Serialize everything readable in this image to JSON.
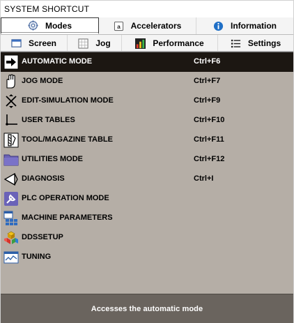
{
  "window": {
    "title": "SYSTEM SHORTCUT"
  },
  "tabs_row1": [
    {
      "label": "Modes",
      "icon": "gear-icon",
      "active": true
    },
    {
      "label": "Accelerators",
      "icon": "key-a-icon",
      "active": false
    },
    {
      "label": "Information",
      "icon": "info-icon",
      "active": false
    }
  ],
  "tabs_row2": [
    {
      "label": "Screen",
      "icon": "screen-icon"
    },
    {
      "label": "Jog",
      "icon": "grid-icon"
    },
    {
      "label": "Performance",
      "icon": "bar-chart-icon"
    },
    {
      "label": "Settings",
      "icon": "list-icon"
    }
  ],
  "list": {
    "items": [
      {
        "label": "AUTOMATIC MODE",
        "shortcut": "Ctrl+F6",
        "icon": "arrow-right-icon",
        "selected": true
      },
      {
        "label": "JOG MODE",
        "shortcut": "Ctrl+F7",
        "icon": "hand-icon",
        "selected": false
      },
      {
        "label": "EDIT-SIMULATION MODE",
        "shortcut": "Ctrl+F9",
        "icon": "x-arrows-icon",
        "selected": false
      },
      {
        "label": "USER TABLES",
        "shortcut": "Ctrl+F10",
        "icon": "axis-icon",
        "selected": false
      },
      {
        "label": "TOOL/MAGAZINE TABLE",
        "shortcut": "Ctrl+F11",
        "icon": "tool-icon",
        "selected": false
      },
      {
        "label": "UTILITIES MODE",
        "shortcut": "Ctrl+F12",
        "icon": "folder-icon",
        "selected": false
      },
      {
        "label": "DIAGNOSIS",
        "shortcut": "Ctrl+I",
        "icon": "diagnosis-icon",
        "selected": false
      },
      {
        "label": "PLC OPERATION MODE",
        "shortcut": "",
        "icon": "plc-icon",
        "selected": false
      },
      {
        "label": "MACHINE PARAMETERS",
        "shortcut": "",
        "icon": "parameters-icon",
        "selected": false
      },
      {
        "label": "DDSSETUP",
        "shortcut": "",
        "icon": "cubes-icon",
        "selected": false
      },
      {
        "label": "TUNING",
        "shortcut": "",
        "icon": "tuning-icon",
        "selected": false
      }
    ]
  },
  "status": {
    "text": "Accesses the automatic mode"
  },
  "colors": {
    "list_background": "#b5aea6",
    "selected_row": "#1c1712",
    "status_bar": "#6a645e"
  }
}
